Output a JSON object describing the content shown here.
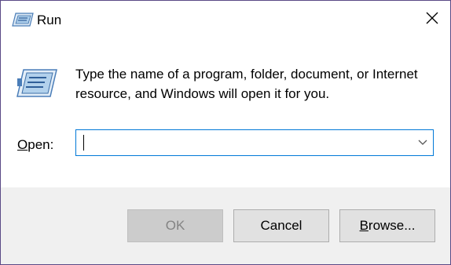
{
  "window": {
    "title": "Run"
  },
  "icons": {
    "title_icon": "run-icon",
    "close_icon": "close-icon",
    "big_icon": "run-icon",
    "dropdown_icon": "chevron-down-icon"
  },
  "content": {
    "description": "Type the name of a program, folder, document, or Internet resource, and Windows will open it for you.",
    "open_label_mnemonic": "O",
    "open_label_rest": "pen:",
    "open_value": ""
  },
  "buttons": {
    "ok_label": "OK",
    "cancel_label": "Cancel",
    "browse_mnemonic": "B",
    "browse_rest": "rowse..."
  },
  "colors": {
    "window_border": "#5a4a86",
    "footer_bg": "#f0f0f0",
    "button_bg": "#e1e1e1",
    "button_disabled_bg": "#cccccc",
    "focus_border": "#0078d7"
  }
}
